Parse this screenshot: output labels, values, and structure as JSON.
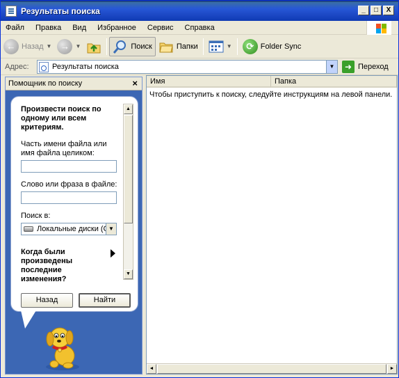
{
  "window": {
    "title": "Результаты поиска"
  },
  "title_buttons": {
    "minimize": "_",
    "maximize": "□",
    "close": "X"
  },
  "menu": [
    "Файл",
    "Правка",
    "Вид",
    "Избранное",
    "Сервис",
    "Справка"
  ],
  "toolbar": {
    "back_label": "Назад",
    "search_label": "Поиск",
    "folders_label": "Папки",
    "folder_sync_label": "Folder Sync"
  },
  "address": {
    "label": "Адрес:",
    "value": "Результаты поиска",
    "go_label": "Переход"
  },
  "search_pane": {
    "title": "Помощник по поиску",
    "heading": "Произвести поиск по одному или всем критериям.",
    "filename_label": "Часть имени файла или имя файла целиком:",
    "filename_value": "",
    "phrase_label": "Слово или фраза в файле:",
    "phrase_value": "",
    "look_in_label": "Поиск в:",
    "look_in_value": "Локальные диски (C:)",
    "modified_label": "Когда были произведены последние изменения?",
    "back_button": "Назад",
    "search_button": "Найти"
  },
  "results": {
    "columns": [
      "Имя",
      "Папка"
    ],
    "empty_message": "Чтобы приступить к поиску, следуйте инструкциям на левой панели."
  },
  "colors": {
    "titlebar": "#2757d6",
    "pane_background": "#3c67b4",
    "window_face": "#ece9d8"
  }
}
